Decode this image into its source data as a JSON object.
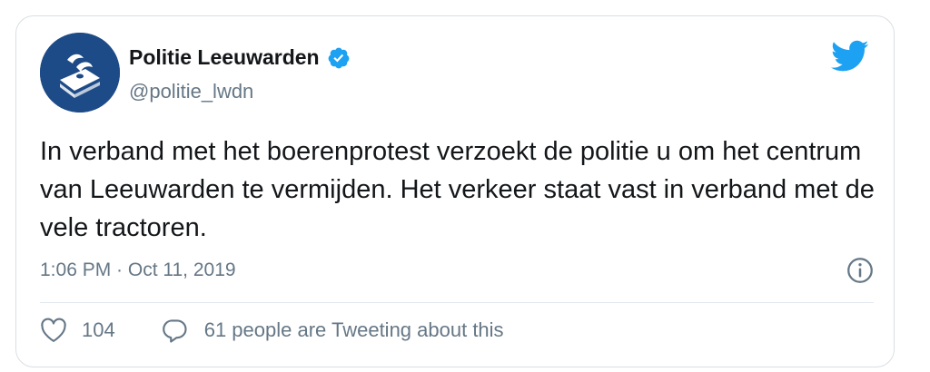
{
  "tweet": {
    "display_name": "Politie Leeuwarden",
    "handle": "@politie_lwdn",
    "text": "In verband met het boerenprotest verzoekt de politie u om het centrum van Leeuwarden te vermijden. Het verkeer staat vast in verband met de vele tractoren.",
    "timestamp": "1:06 PM · Oct 11, 2019",
    "like_count": "104",
    "reply_label": "61 people are Tweeting about this"
  },
  "icons": {
    "avatar": "police-logo-icon",
    "verified": "verified-badge-icon",
    "platform": "twitter-bird-icon",
    "info": "info-icon",
    "like": "heart-icon",
    "reply": "speech-bubble-icon"
  },
  "colors": {
    "brand_blue": "#1da1f2",
    "avatar_bg": "#1d4b87",
    "text": "#14171a",
    "muted": "#657786",
    "border": "#d9dfe4"
  }
}
